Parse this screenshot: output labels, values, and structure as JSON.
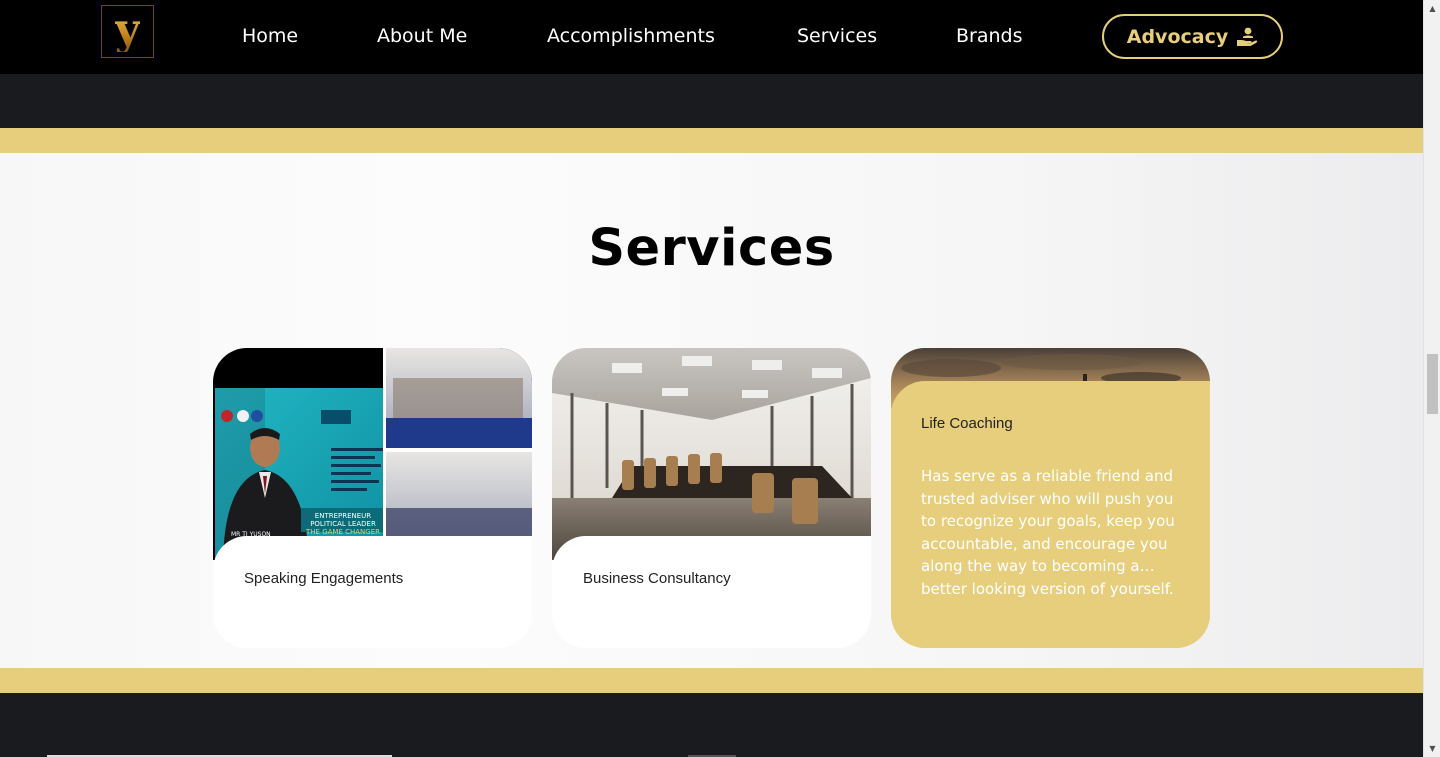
{
  "nav": {
    "logo_letter": "y",
    "items": [
      "Home",
      "About Me",
      "Accomplishments",
      "Services",
      "Brands"
    ],
    "advocacy_label": "Advocacy",
    "accent": "#e6ce7c"
  },
  "services": {
    "title": "Services",
    "cards": [
      {
        "label": "Speaking Engagements"
      },
      {
        "label": "Business Consultancy"
      },
      {
        "label": "Life Coaching",
        "description": "Has serve as a reliable friend and trusted adviser who will push you to recognize your goals, keep you accountable, and encourage you along the way to becoming a… better looking version of yourself."
      }
    ],
    "poster": {
      "name": "MR TJ YUSON",
      "tagline": "ENTREPRENEUR POLITICAL LEADER THE GAME CHANGER",
      "event": "HPI TALKS"
    }
  }
}
